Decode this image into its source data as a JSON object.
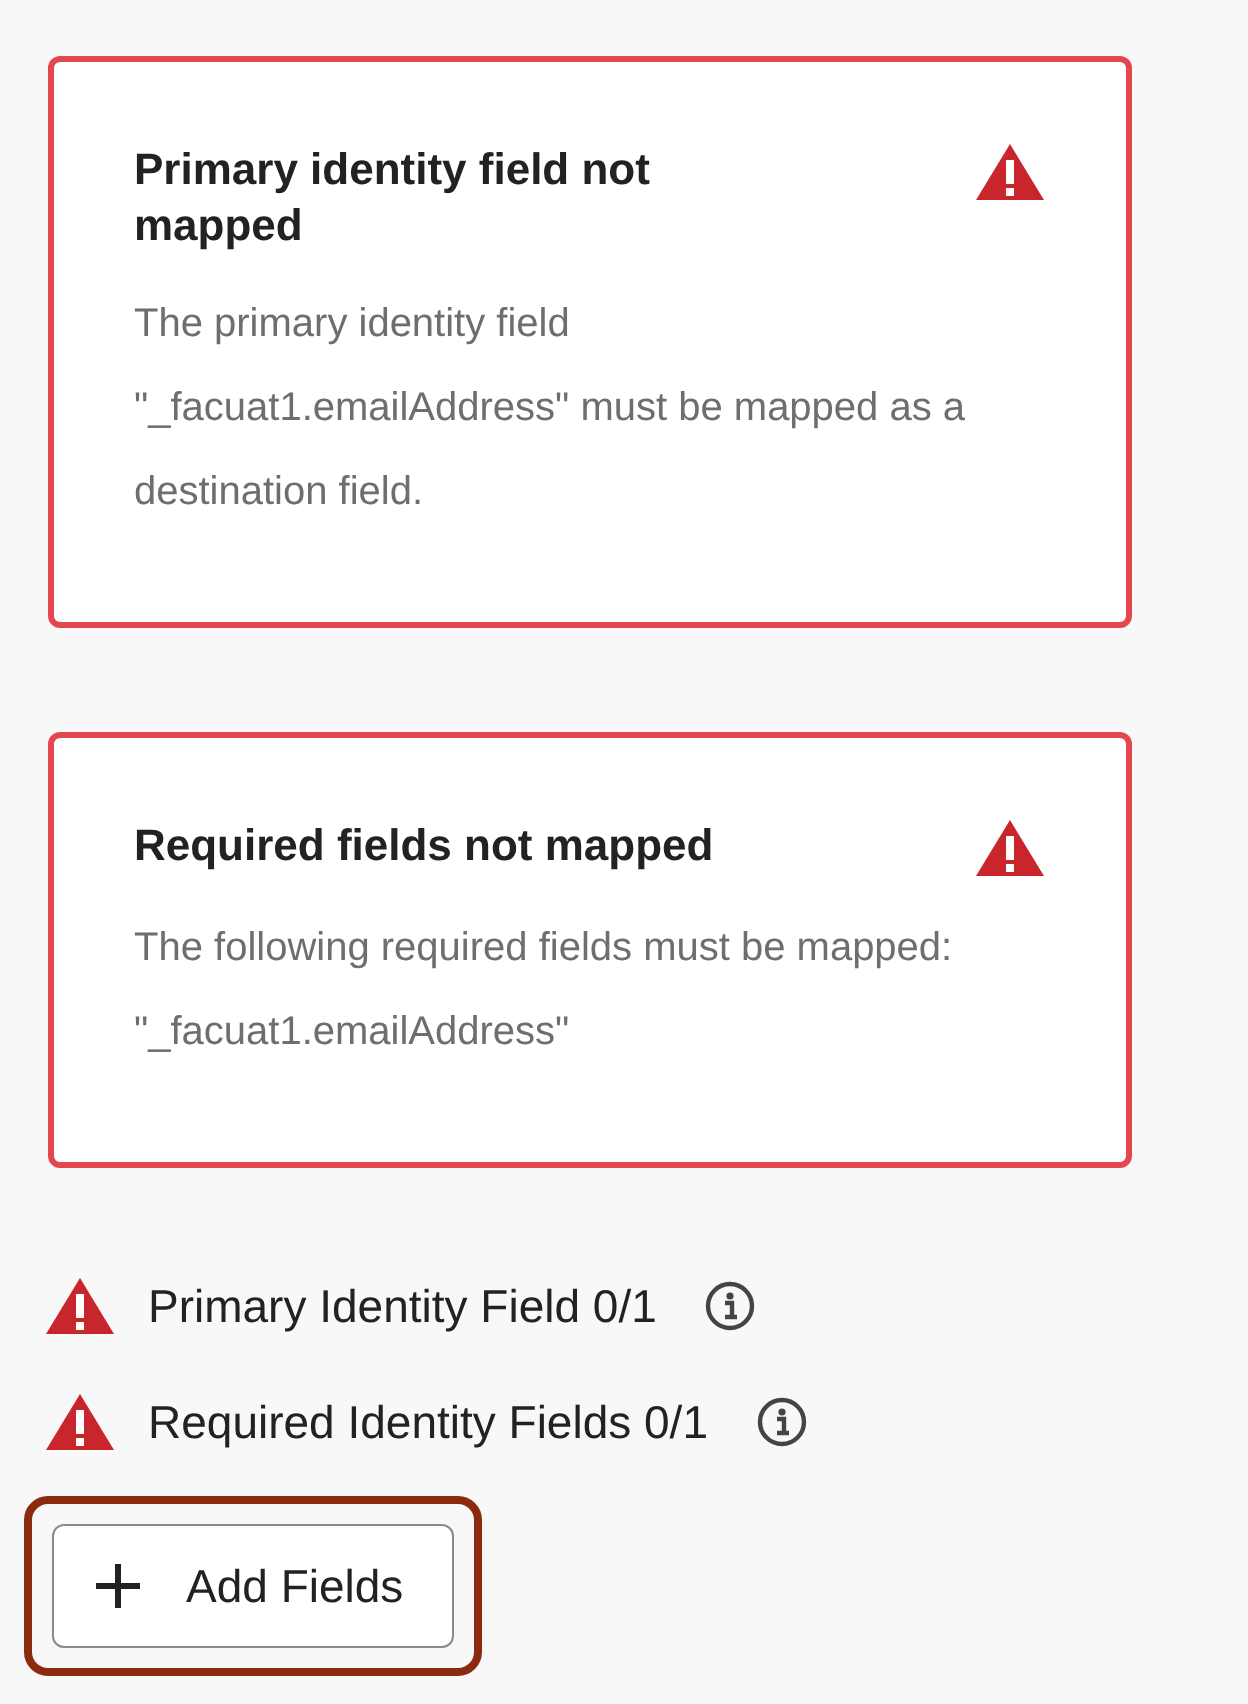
{
  "alerts": [
    {
      "title": "Primary identity field not mapped",
      "message": "The primary identity field \"_facuat1.emailAddress\" must be mapped as a destination field."
    },
    {
      "title": "Required fields not mapped",
      "message": "The following required fields must be mapped: \"_facuat1.emailAddress\""
    }
  ],
  "requirements": [
    {
      "label": "Primary Identity Field 0/1",
      "met": false
    },
    {
      "label": "Required Identity Fields 0/1",
      "met": false
    }
  ],
  "add_button": {
    "label": "Add Fields",
    "highlighted": true
  }
}
